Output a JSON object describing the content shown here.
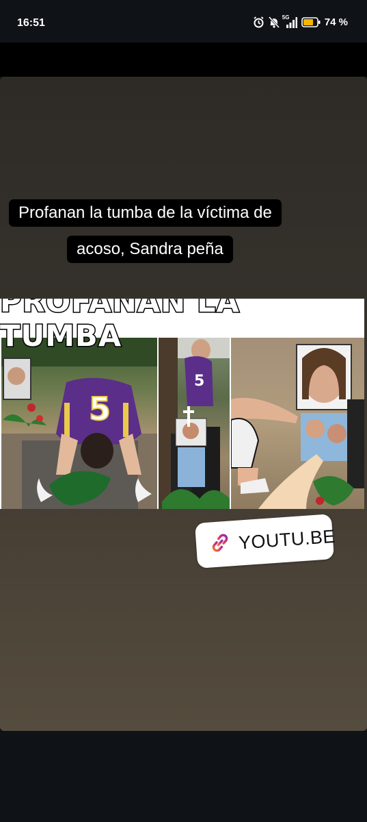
{
  "status_bar": {
    "time": "16:51",
    "icons": [
      "alarm-icon",
      "mute-icon",
      "signal-5g-icon",
      "battery-icon"
    ],
    "network_label": "5G",
    "battery_percent": "74 %",
    "battery_level": 0.74,
    "battery_color": "#f5b400"
  },
  "story": {
    "caption_lines": [
      "Profanan la tumba de la víctima de",
      "acoso, Sandra peña"
    ],
    "thumbnail_title": "PROFANAN LA TUMBA",
    "jersey_number": "5",
    "link_sticker": {
      "icon": "link-icon",
      "label": "YOUTU.BE"
    }
  }
}
